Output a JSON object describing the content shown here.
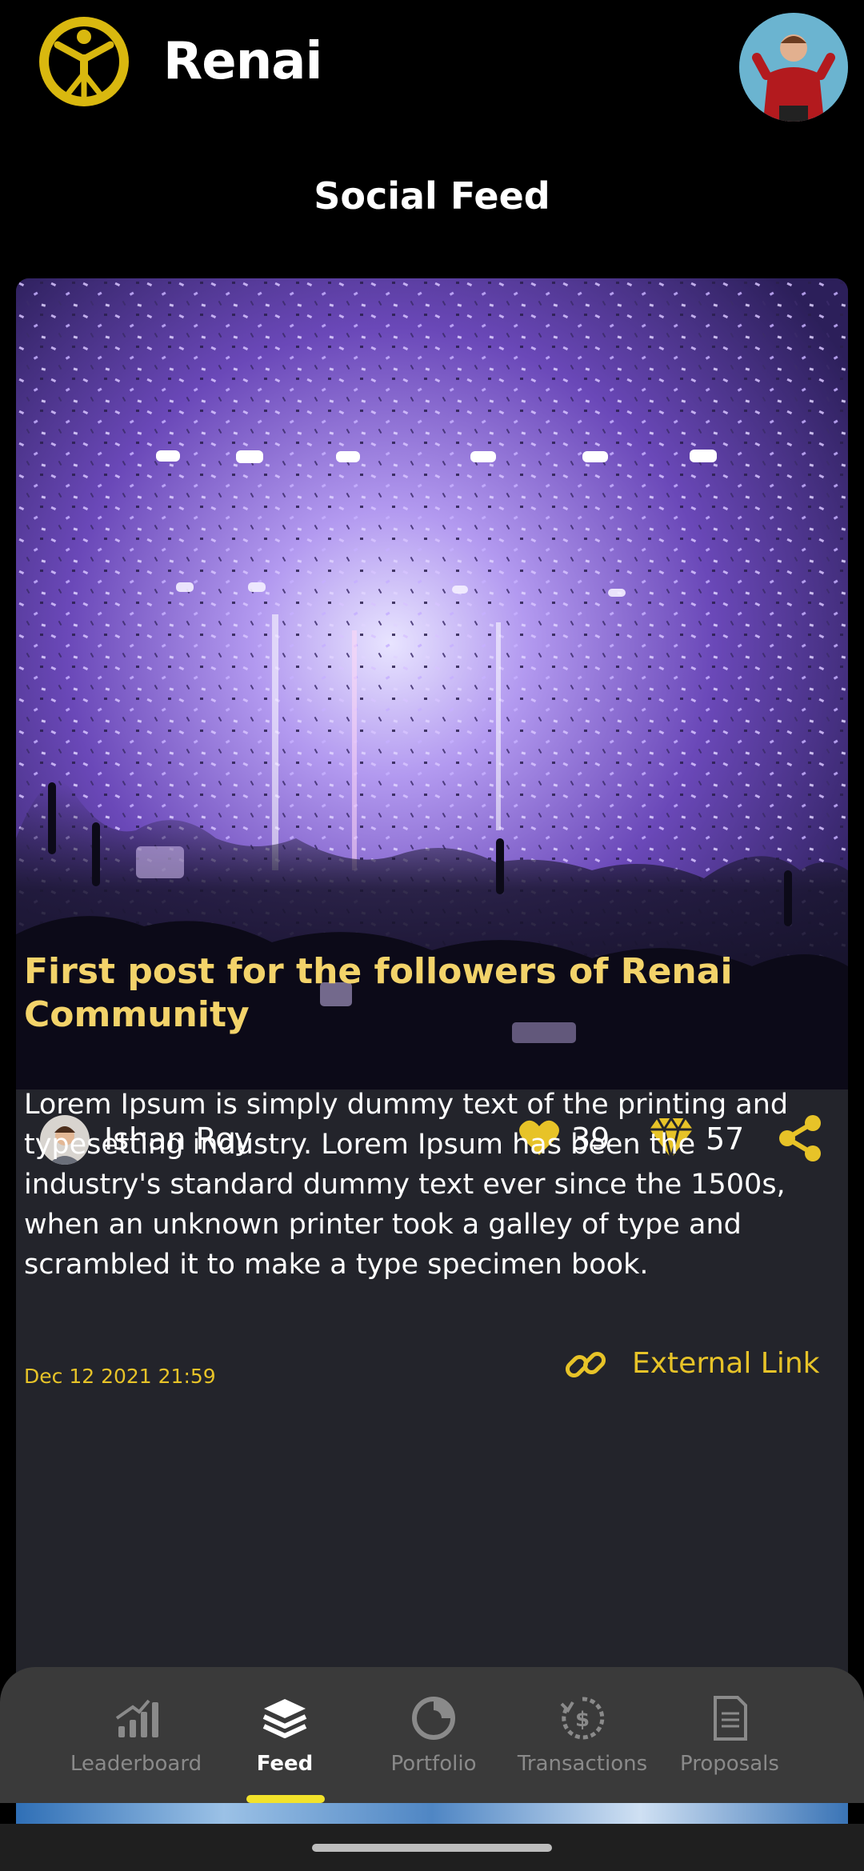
{
  "app": {
    "title": "Renai"
  },
  "page": {
    "title": "Social Feed"
  },
  "post": {
    "author": "Ishan Roy",
    "likes": "39",
    "gems": "57",
    "title": "First post for the followers of Renai Community",
    "body": "Lorem Ipsum is simply dummy text of the printing and typesetting industry. Lorem Ipsum has been the industry's standard dummy text ever since the 1500s, when an unknown printer took a galley of type and scrambled it to make a type specimen book.",
    "date": "Dec 12 2021 21:59",
    "external_link_label": "External Link"
  },
  "nav": {
    "items": [
      {
        "label": "Leaderboard",
        "icon": "bar-chart-icon",
        "active": false
      },
      {
        "label": "Feed",
        "icon": "layers-icon",
        "active": true
      },
      {
        "label": "Portfolio",
        "icon": "pie-chart-icon",
        "active": false
      },
      {
        "label": "Transactions",
        "icon": "dollar-cycle-icon",
        "active": false
      },
      {
        "label": "Proposals",
        "icon": "document-icon",
        "active": false
      }
    ]
  },
  "colors": {
    "accent": "#e7c328",
    "title_yellow": "#f3d36a",
    "card_bg": "#23242b",
    "nav_bg": "#3a3a3a",
    "indicator": "#f2e22a"
  }
}
